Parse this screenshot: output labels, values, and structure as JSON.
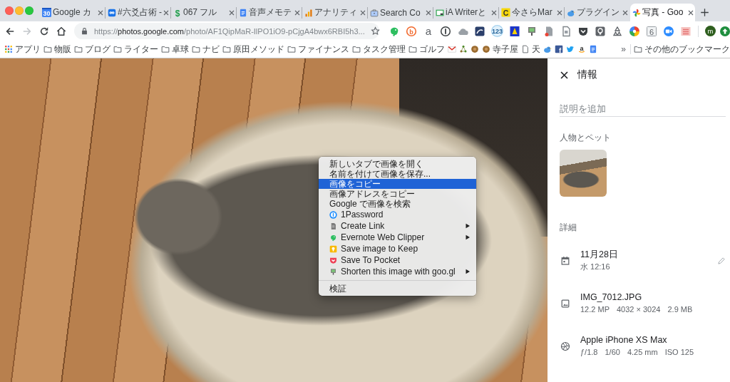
{
  "tabs": [
    {
      "title": "Google カ",
      "kind": "calendar",
      "icon_text": "30",
      "selected": false
    },
    {
      "title": "#六爻占術 -",
      "kind": "infinity",
      "selected": false
    },
    {
      "title": "067 フル",
      "kind": "dollar",
      "icon_text": "$",
      "selected": false
    },
    {
      "title": "音声メモテ",
      "kind": "document",
      "selected": false
    },
    {
      "title": "アナリティ",
      "kind": "bars",
      "selected": false
    },
    {
      "title": "Search Co",
      "kind": "toolbox",
      "selected": false
    },
    {
      "title": "iA Writerと",
      "kind": "frame",
      "selected": false
    },
    {
      "title": "今さらMar",
      "kind": "letter",
      "icon_text": "C",
      "selected": false
    },
    {
      "title": "プラグイン",
      "kind": "bird",
      "selected": false
    },
    {
      "title": "写真 - Goo",
      "kind": "pinwheel",
      "selected": true
    }
  ],
  "toolbar": {
    "navigation": [
      {
        "kind": "back",
        "disabled": false
      },
      {
        "kind": "forward",
        "disabled": true
      },
      {
        "kind": "reload",
        "disabled": false
      },
      {
        "kind": "home",
        "disabled": false
      }
    ],
    "url": {
      "scheme": "https://",
      "host": "photos.google.com",
      "path": "/photo/AF1QipMaR-IlPO1iO9-pCjgA4bwx6RBI5h3..."
    },
    "bookmarked": false,
    "extensions": [
      {
        "kind": "elephant"
      },
      {
        "kind": "ring",
        "text": "b"
      },
      {
        "kind": "letter",
        "text": "a"
      },
      {
        "kind": "keyhole"
      },
      {
        "kind": "cloud"
      },
      {
        "kind": "swoosh"
      },
      {
        "kind": "badge",
        "text": "123"
      },
      {
        "kind": "bell"
      },
      {
        "kind": "monitor"
      },
      {
        "kind": "pagedot"
      },
      {
        "kind": "page"
      },
      {
        "kind": "shield"
      },
      {
        "kind": "bulb"
      },
      {
        "kind": "recycle"
      },
      {
        "kind": "wheel"
      },
      {
        "kind": "box",
        "text": "6"
      },
      {
        "kind": "video"
      },
      {
        "kind": "lines"
      }
    ],
    "account": [
      {
        "kind": "avatar",
        "text": "m"
      },
      {
        "kind": "update"
      }
    ]
  },
  "bookmarks": {
    "items": [
      {
        "kind": "apps",
        "label": "アプリ"
      },
      {
        "kind": "folder",
        "label": "物販"
      },
      {
        "kind": "folder",
        "label": "ブログ"
      },
      {
        "kind": "folder",
        "label": "ライター"
      },
      {
        "kind": "folder",
        "label": "卓球"
      },
      {
        "kind": "folder",
        "label": "ナビ"
      },
      {
        "kind": "folder",
        "label": "原田メソッド"
      },
      {
        "kind": "folder",
        "label": "ファイナンス"
      },
      {
        "kind": "folder",
        "label": "タスク管理"
      },
      {
        "kind": "folder",
        "label": "ゴルフ"
      },
      {
        "kind": "mail"
      },
      {
        "kind": "network"
      },
      {
        "kind": "coin"
      },
      {
        "kind": "coin",
        "label": "寺子屋"
      },
      {
        "kind": "page",
        "label": "天"
      },
      {
        "kind": "chick"
      },
      {
        "kind": "tile",
        "text": "f"
      },
      {
        "kind": "bird"
      },
      {
        "kind": "smile",
        "text": "a"
      },
      {
        "kind": "docs"
      }
    ],
    "overflow": "»",
    "other": {
      "kind": "folder",
      "label": "その他のブックマーク"
    }
  },
  "context_menu": {
    "groups": [
      {
        "items": [
          {
            "label": "新しいタブで画像を開く",
            "kind": "plain",
            "selected": false,
            "submenu": false
          },
          {
            "label": "名前を付けて画像を保存...",
            "kind": "plain",
            "selected": false,
            "submenu": false
          },
          {
            "label": "画像をコピー",
            "kind": "plain",
            "selected": true,
            "submenu": false
          },
          {
            "label": "画像アドレスをコピー",
            "kind": "plain",
            "selected": false,
            "submenu": false
          },
          {
            "label": "Google で画像を検索",
            "kind": "plain",
            "selected": false,
            "submenu": false
          },
          {
            "label": "1Password",
            "kind": "keyhole",
            "selected": false,
            "submenu": false
          },
          {
            "label": "Create Link",
            "kind": "page",
            "selected": false,
            "submenu": true
          },
          {
            "label": "Evernote Web Clipper",
            "kind": "elephant",
            "selected": false,
            "submenu": true
          },
          {
            "label": "Save image to Keep",
            "kind": "bulb",
            "selected": false,
            "submenu": false
          },
          {
            "label": "Save To Pocket",
            "kind": "shield",
            "selected": false,
            "submenu": false
          },
          {
            "label": "Shorten this image with goo.gl",
            "kind": "monitor",
            "selected": false,
            "submenu": true
          }
        ]
      },
      {
        "items": [
          {
            "label": "検証",
            "kind": "plain",
            "selected": false,
            "submenu": false
          }
        ]
      }
    ]
  },
  "info_panel": {
    "title": "情報",
    "description": {
      "placeholder": "説明を追加"
    },
    "people": {
      "heading": "人物とペット"
    },
    "details": {
      "heading": "詳細",
      "items": [
        {
          "kind": "date",
          "title": "11月28日",
          "parts": [
            "水 12:16"
          ],
          "editable": true
        },
        {
          "kind": "image",
          "title": "IMG_7012.JPG",
          "parts": [
            "12.2 MP",
            "4032 × 3024",
            "2.9 MB"
          ],
          "editable": false
        },
        {
          "kind": "camera",
          "title": "Apple iPhone XS Max",
          "parts": [
            "ƒ/1.8",
            "1/60",
            "4.25 mm",
            "ISO 125"
          ],
          "editable": false
        }
      ]
    }
  }
}
